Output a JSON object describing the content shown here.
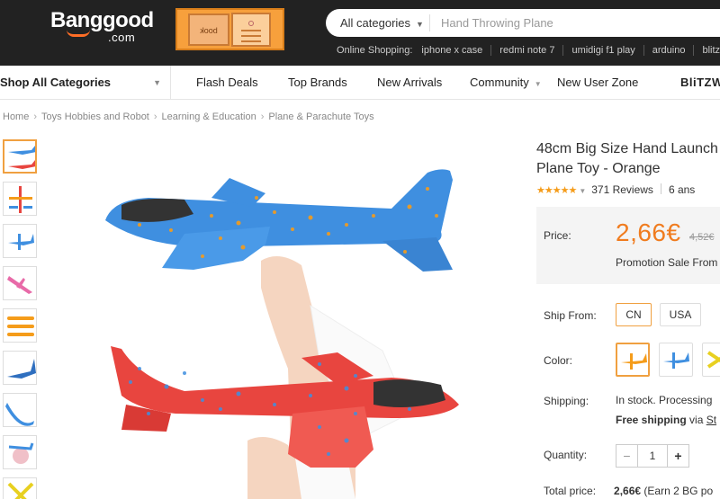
{
  "header": {
    "logo_main": "Banggood",
    "logo_sub": ".com",
    "search_category": "All categories",
    "search_placeholder": "Hand Throwing Plane",
    "hotwords_label": "Online Shopping:",
    "hotwords": [
      "iphone x case",
      "redmi note 7",
      "umidigi f1 play",
      "arduino",
      "blitzw"
    ]
  },
  "nav": {
    "all_categories": "Shop All Categories",
    "items": [
      "Flash Deals",
      "Top Brands",
      "New Arrivals",
      "Community",
      "New User Zone",
      "BliTZW"
    ]
  },
  "breadcrumb": [
    "Home",
    "Toys Hobbies and Robot",
    "Learning & Education",
    "Plane & Parachute Toys"
  ],
  "product": {
    "title_line1": "48cm Big Size Hand Launch",
    "title_line2": "Plane Toy - Orange",
    "stars": "★★★★★",
    "reviews": "371 Reviews",
    "answers": "6 ans",
    "price_label": "Price:",
    "price": "2,66€",
    "old_price": "4,52€",
    "promo": "Promotion Sale From",
    "ship_from_label": "Ship From:",
    "ship_from_options": [
      "CN",
      "USA"
    ],
    "color_label": "Color:",
    "shipping_label": "Shipping:",
    "shipping_status": "In stock. Processing",
    "free_shipping": "Free shipping",
    "via": "via",
    "shipping_link": "St",
    "quantity_label": "Quantity:",
    "quantity_minus": "−",
    "quantity_value": "1",
    "quantity_plus": "+",
    "total_label": "Total price:",
    "total_value": "2,66€",
    "total_note": "(Earn 2 BG po"
  },
  "colors": {
    "accent": "#f07c1f",
    "header_bg": "#222222",
    "plane_blue": "#3f8fe0",
    "plane_red": "#e8453f",
    "plane_orange": "#f59c1a"
  }
}
